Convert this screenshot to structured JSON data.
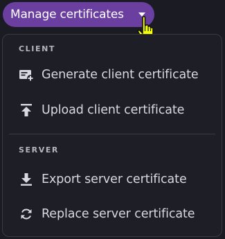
{
  "trigger": {
    "label": "Manage certificates"
  },
  "menu": {
    "sections": [
      {
        "title": "CLIENT",
        "items": [
          {
            "label": "Generate client certificate",
            "icon": "add-certificate-icon"
          },
          {
            "label": "Upload client certificate",
            "icon": "upload-icon"
          }
        ]
      },
      {
        "title": "SERVER",
        "items": [
          {
            "label": "Export server certificate",
            "icon": "download-icon"
          },
          {
            "label": "Replace server certificate",
            "icon": "replace-icon"
          }
        ]
      }
    ]
  },
  "colors": {
    "accent": "#6b3fa0",
    "background": "#1b1b24",
    "menu_background": "#1e1e27",
    "text": "#d9d9e2",
    "cursor": "#f6ff00"
  }
}
